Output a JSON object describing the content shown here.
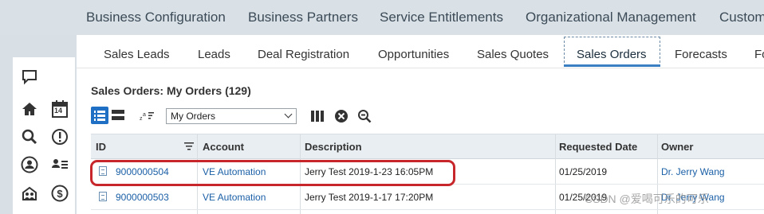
{
  "top_nav": {
    "items": [
      "Business Configuration",
      "Business Partners",
      "Service Entitlements",
      "Organizational Management",
      "Custom"
    ]
  },
  "sidebar": {
    "icons": [
      "chat-icon",
      "home-icon",
      "calendar-icon",
      "search-icon",
      "alert-icon",
      "person-icon",
      "contacts-icon",
      "team-icon",
      "dollar-icon"
    ],
    "calendar_day": "14"
  },
  "tabs": {
    "items": [
      "Sales Leads",
      "Leads",
      "Deal Registration",
      "Opportunities",
      "Sales Quotes",
      "Sales Orders",
      "Forecasts",
      "Fo"
    ],
    "active": "Sales Orders"
  },
  "page": {
    "title": "Sales Orders: My Orders (129)"
  },
  "toolbar": {
    "view_selected": "My Orders"
  },
  "table": {
    "headers": [
      "ID",
      "Account",
      "Description",
      "Requested Date",
      "Owner"
    ],
    "rows": [
      {
        "id": "9000000504",
        "account": "VE Automation",
        "description": "Jerry Test 2019-1-23 16:05PM",
        "requested_date": "01/25/2019",
        "owner": "Dr. Jerry Wang"
      },
      {
        "id": "9000000503",
        "account": "VE Automation",
        "description": "Jerry Test 2019-1-17 17:20PM",
        "requested_date": "01/25/2019",
        "owner": "Dr. Jerry Wang"
      }
    ]
  },
  "watermark": "CSDN @爱喝可乐的可乐",
  "colors": {
    "accent": "#1f6fc5",
    "highlight": "#c7262b",
    "link": "#1a5fa6"
  }
}
